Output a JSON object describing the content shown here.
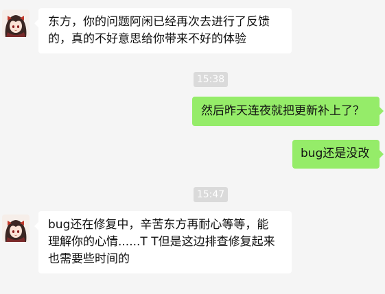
{
  "colors": {
    "background": "#f5f5f5",
    "bubble_other": "#ffffff",
    "bubble_self": "#95ec69",
    "timestamp_bg": "#dadada"
  },
  "chat": {
    "avatar_icon": "anime-girl-avatar-icon",
    "messages": [
      {
        "outgoing": false,
        "lines": [
          "东方，你的问题阿闲已经再次去进行了反馈",
          "的，真的不好意思给你带来不好的体验"
        ]
      },
      {
        "time": "15:38"
      },
      {
        "outgoing": true,
        "lines": [
          "然后昨天连夜就把更新补上了？"
        ]
      },
      {
        "outgoing": true,
        "lines": [
          "bug还是没改"
        ]
      },
      {
        "time": "15:47"
      },
      {
        "outgoing": false,
        "lines": [
          "bug还在修复中，辛苦东方再耐心等等，能",
          "理解你的心情......T T但是这边排查修复起来",
          "也需要些时间的"
        ]
      }
    ]
  }
}
